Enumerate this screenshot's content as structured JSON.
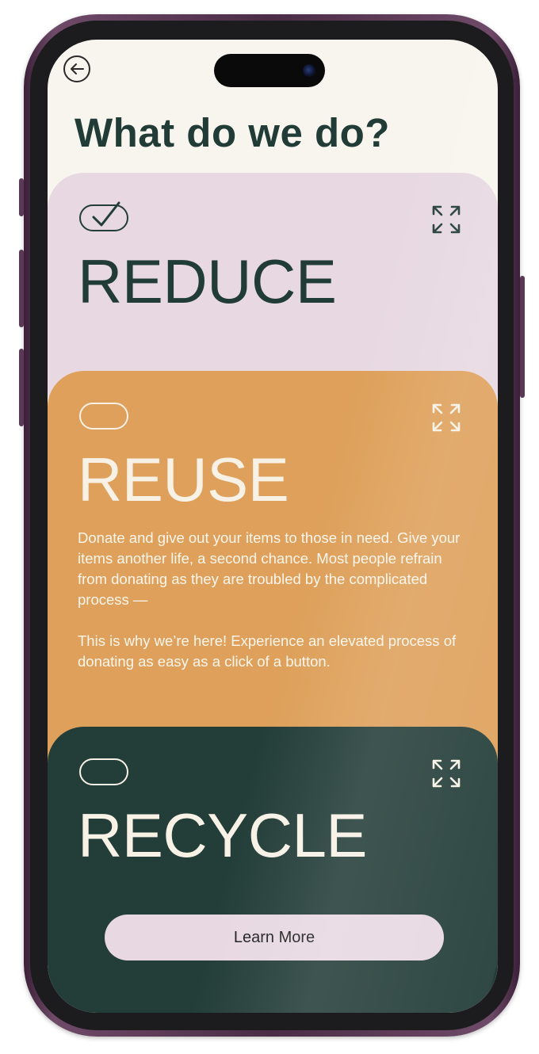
{
  "app": {
    "page_title": "What do we do?"
  },
  "cards": {
    "reduce": {
      "title": "REDUCE",
      "selected": true
    },
    "reuse": {
      "title": "REUSE",
      "selected": false,
      "paragraph1": "Donate and give out your items to those in need. Give your items another life, a second chance. Most people refrain from donating as they are troubled by the complicated process —",
      "paragraph2": "This is why we’re here! Experience an elevated process of donating as easy as a click of a button."
    },
    "recycle": {
      "title": "RECYCLE",
      "selected": false
    }
  },
  "actions": {
    "learn_more_label": "Learn More"
  },
  "colors": {
    "background": "#f8f5ee",
    "reduce_card": "#e7d8e1",
    "reuse_card": "#dea05a",
    "recycle_card": "#233d38",
    "dark_text": "#213b36",
    "light_text": "#f7f1e6",
    "frame": "#4a2c46"
  },
  "icons": {
    "back": "arrow-left-circle-icon",
    "check": "checkmark-icon",
    "expand": "expand-arrows-icon"
  }
}
